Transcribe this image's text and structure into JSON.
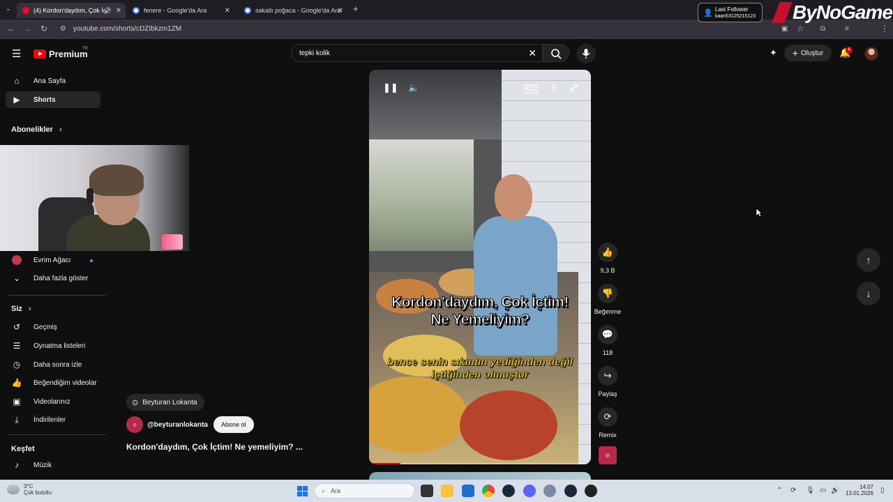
{
  "browser": {
    "tabs": [
      {
        "title": "(4) Kordon'daydım, Çok İçti",
        "active": true,
        "favicon_color": "#ff0033"
      },
      {
        "title": "fenere - Google'da Ara",
        "active": false,
        "favicon_color": "#4285f4"
      },
      {
        "title": "sakallı poğaca - Google'da Ara",
        "active": false,
        "favicon_color": "#4285f4"
      }
    ],
    "url": "youtube.com/shorts/cDZIbkzm1ZM"
  },
  "overlay": {
    "follower_title": "Last Follower",
    "follower_name": "kaan53125215123",
    "brand": "ByNoGame"
  },
  "header": {
    "logo_word": "Premium",
    "logo_region": "TR",
    "search_query": "tepki kolik",
    "create_label": "Oluştur",
    "notification_count": "4"
  },
  "sidebar": {
    "top_items": [
      {
        "label": "Ana Sayfa",
        "icon": "home-icon",
        "active": false
      },
      {
        "label": "Shorts",
        "icon": "shorts-icon",
        "active": true
      }
    ],
    "subscriptions_heading": "Abonelikler",
    "subscriptions": [
      {
        "label": "Evrim Ağacı",
        "icon": "channel-avatar",
        "new": true
      }
    ],
    "show_more": "Daha fazla göster",
    "you_heading": "Siz",
    "you_items": [
      {
        "label": "Geçmiş",
        "icon": "history-icon"
      },
      {
        "label": "Oynatma listeleri",
        "icon": "playlist-icon"
      },
      {
        "label": "Daha sonra izle",
        "icon": "clock-icon"
      },
      {
        "label": "Beğendiğim videolar",
        "icon": "like-icon"
      },
      {
        "label": "Videolarınız",
        "icon": "video-icon"
      },
      {
        "label": "İndirilenler",
        "icon": "download-icon"
      }
    ],
    "explore_heading": "Keşfet",
    "explore_items": [
      {
        "label": "Müzik",
        "icon": "music-icon"
      }
    ]
  },
  "video": {
    "caption_line1": "Kordon'daydım, Çok İçtim!",
    "caption_line2": "Ne Yemeliyim?",
    "subtitle_line1": "bence senin sıkıntın yediğinden değil",
    "subtitle_line2": "içtiğinden olmuştur",
    "progress": 0.14
  },
  "actions": {
    "like_count": "9,3 B",
    "dislike_label": "Beğenme",
    "comment_count": "118",
    "share_label": "Paylaş",
    "remix_label": "Remix"
  },
  "meta": {
    "location": "Beyturan Lokanta",
    "channel_handle": "@beyturanlokanta",
    "subscribe_label": "Abone ol",
    "title": "Kordon'daydım, Çok İçtim! Ne yemeliyim? ..."
  },
  "taskbar": {
    "temperature": "3°C",
    "weather": "Çok bulutlu",
    "search_placeholder": "Ara",
    "time": "14:07",
    "date": "13.01.2026"
  }
}
